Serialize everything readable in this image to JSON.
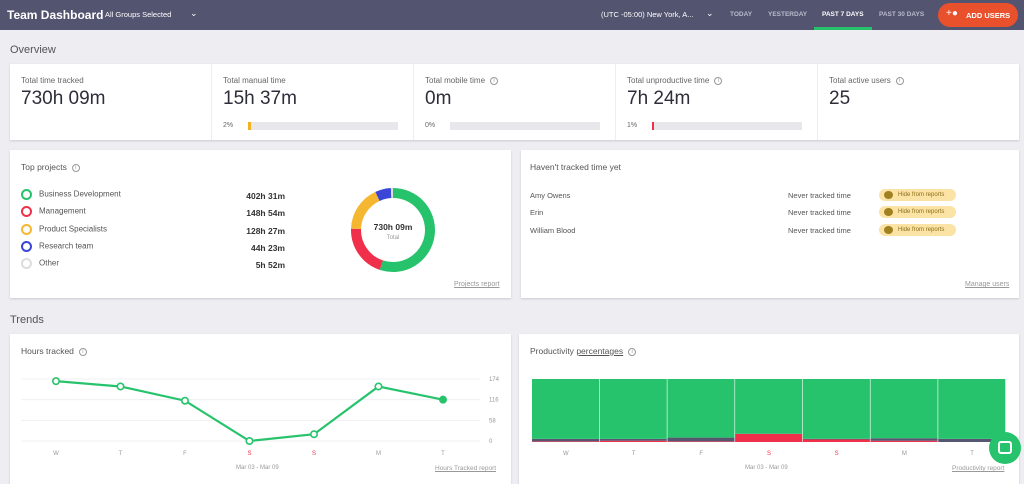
{
  "header": {
    "title": "Team Dashboard",
    "group_select": "All Groups Selected",
    "timezone": "(UTC -05:00) New York, A...",
    "ranges": [
      "TODAY",
      "YESTERDAY",
      "PAST 7 DAYS",
      "PAST 30 DAYS"
    ],
    "active_range": "PAST 7 DAYS",
    "add_users": "ADD USERS",
    "accent": "#e9502c"
  },
  "overview": {
    "title": "Overview",
    "stats": [
      {
        "label": "Total time tracked",
        "value": "730h 09m"
      },
      {
        "label": "Total manual time",
        "value": "15h 37m",
        "percent_label": "2%",
        "percent": 2,
        "color": "#f5b120"
      },
      {
        "label": "Total mobile time",
        "value": "0m",
        "percent_label": "0%",
        "percent": 0,
        "color": "#cccccc"
      },
      {
        "label": "Total unproductive time",
        "value": "7h 24m",
        "percent_label": "1%",
        "percent": 1,
        "color": "#f0304a"
      },
      {
        "label": "Total active users",
        "value": "25"
      }
    ]
  },
  "projects": {
    "title": "Top projects",
    "total": "730h 09m",
    "total_label": "Total",
    "report_link": "Projects report",
    "items": [
      {
        "name": "Business Development",
        "time": "402h 31m",
        "hours": 402.5,
        "color": "#27c36c"
      },
      {
        "name": "Management",
        "time": "148h 54m",
        "hours": 148.9,
        "color": "#f0304a"
      },
      {
        "name": "Product Specialists",
        "time": "128h 27m",
        "hours": 128.45,
        "color": "#f5b730"
      },
      {
        "name": "Research team",
        "time": "44h 23m",
        "hours": 44.4,
        "color": "#3b45d8"
      },
      {
        "name": "Other",
        "time": "5h 52m",
        "hours": 5.9,
        "color": "#dddddd"
      }
    ]
  },
  "untracked": {
    "title": "Haven't tracked time yet",
    "manage_link": "Manage users",
    "users": [
      {
        "name": "Amy Owens",
        "status": "Never tracked time",
        "action": "Hide from reports"
      },
      {
        "name": "Erin",
        "status": "Never tracked time",
        "action": "Hide from reports"
      },
      {
        "name": "William Blood",
        "status": "Never tracked time",
        "action": "Hide from reports"
      }
    ]
  },
  "trends": {
    "title": "Trends"
  },
  "hours_chart": {
    "title": "Hours tracked",
    "date_range": "Mar 03 - Mar 09",
    "report_link": "Hours Tracked report"
  },
  "productivity_chart": {
    "title_prefix": "Productivity",
    "title_link": "percentages",
    "date_range": "Mar 03 - Mar 09",
    "report_link": "Productivity report"
  },
  "chart_data": [
    {
      "type": "line",
      "categories": [
        "W",
        "T",
        "F",
        "S",
        "S",
        "M",
        "T"
      ],
      "weekend": [
        3,
        4
      ],
      "values": [
        168,
        153,
        113,
        0,
        19,
        153,
        116
      ],
      "yticks": [
        0,
        58,
        116,
        174
      ],
      "ylim": [
        0,
        174
      ],
      "color": "#27c36c",
      "grid": true
    },
    {
      "type": "bar",
      "stacked": true,
      "categories": [
        "W",
        "T",
        "F",
        "S",
        "S",
        "M",
        "T"
      ],
      "ylim": [
        0,
        100
      ],
      "series": [
        {
          "key": "productive",
          "color": "#27c36c",
          "values": [
            95,
            95,
            93,
            87,
            95,
            94,
            95
          ]
        },
        {
          "key": "neutral",
          "color": "#555770",
          "values": [
            4,
            3,
            6,
            0,
            1,
            4,
            5
          ]
        },
        {
          "key": "unproductive",
          "color": "#f0304a",
          "values": [
            1,
            2,
            1,
            13,
            4,
            2,
            0
          ]
        }
      ]
    }
  ]
}
